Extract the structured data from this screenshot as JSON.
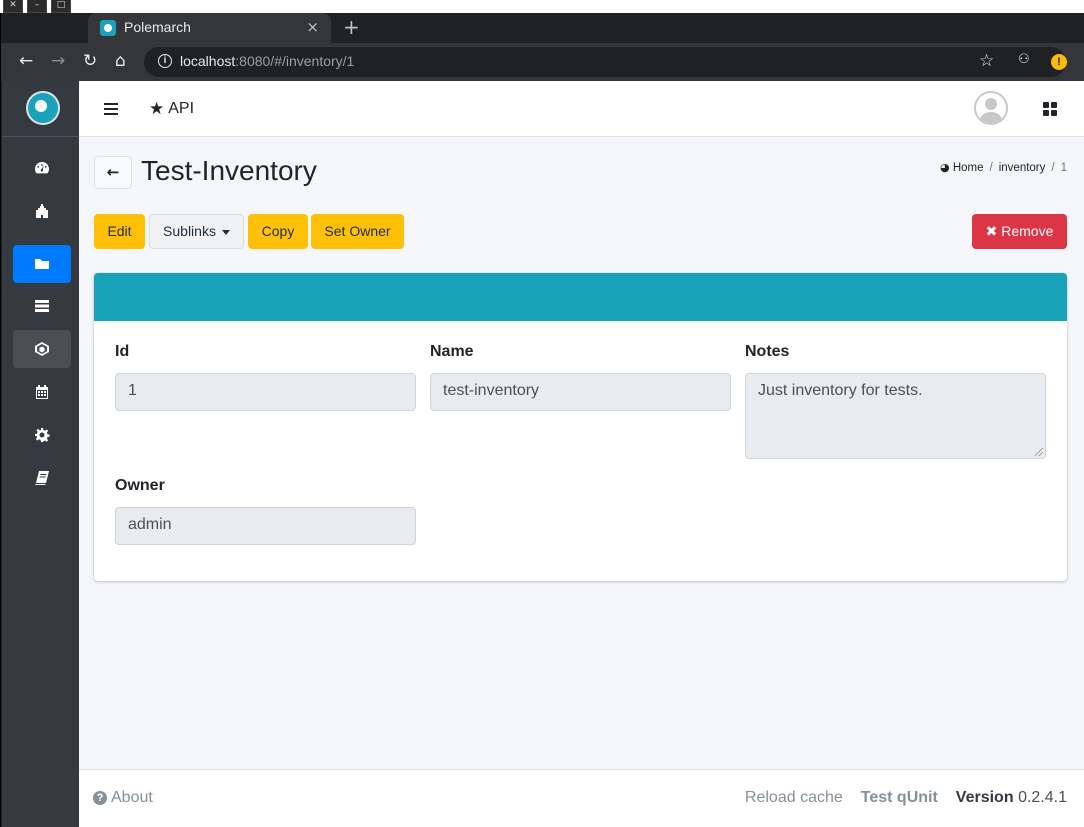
{
  "browser": {
    "tab_title": "Polemarch",
    "tab_close": "×",
    "new_tab": "+",
    "url_host": "localhost",
    "url_rest": ":8080/#/inventory/1"
  },
  "navbar": {
    "api_label": "API"
  },
  "page": {
    "title": "Test-Inventory",
    "breadcrumb": {
      "home": "Home",
      "inventory": "inventory",
      "current": "1",
      "separator": "/"
    }
  },
  "actions": {
    "edit": "Edit",
    "sublinks": "Sublinks",
    "copy": "Copy",
    "set_owner": "Set Owner",
    "remove": "Remove"
  },
  "fields": {
    "id": {
      "label": "Id",
      "value": "1"
    },
    "name": {
      "label": "Name",
      "value": "test-inventory"
    },
    "notes": {
      "label": "Notes",
      "value": "Just inventory for tests."
    },
    "owner": {
      "label": "Owner",
      "value": "admin"
    }
  },
  "footer": {
    "about": "About",
    "reload_cache": "Reload cache",
    "test_qunit": "Test qUnit",
    "version_label": "Version",
    "version_value": "0.2.4.1"
  },
  "colors": {
    "accent": "#17a2b8",
    "warning": "#ffc107",
    "danger": "#dc3545",
    "primary": "#007bff",
    "sidebar": "#343a40"
  },
  "icons": {
    "sidebar": [
      "dashboard-icon",
      "projects-icon",
      "inventory-folder-icon",
      "hosts-icon",
      "templates-icon",
      "calendar-icon",
      "settings-icon",
      "docs-icon"
    ]
  }
}
